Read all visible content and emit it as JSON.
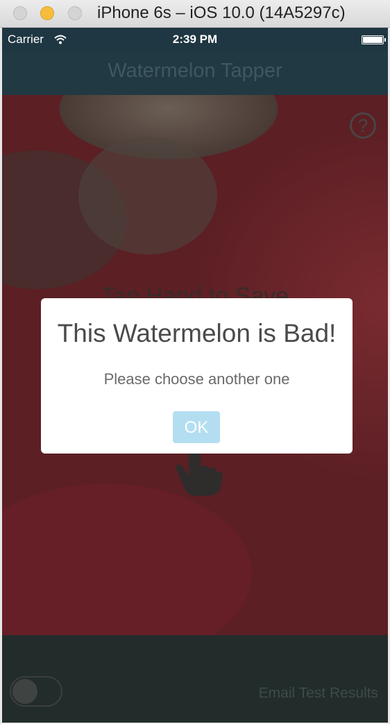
{
  "window": {
    "title": "iPhone 6s – iOS 10.0 (14A5297c)"
  },
  "status_bar": {
    "carrier": "Carrier",
    "time": "2:39 PM"
  },
  "nav_bar": {
    "title": "Watermelon Tapper"
  },
  "main": {
    "help_glyph": "?",
    "instruction": "Tap Hand to Save"
  },
  "alert": {
    "title": "This Watermelon is Bad!",
    "message": "Please choose another one",
    "ok_label": "OK"
  },
  "bottom_bar": {
    "toggle_on": false,
    "email_label": "Email Test Results"
  },
  "colors": {
    "alert_button": "#b3def1",
    "nav_bar": "#213943",
    "background": "#5b1f24"
  }
}
